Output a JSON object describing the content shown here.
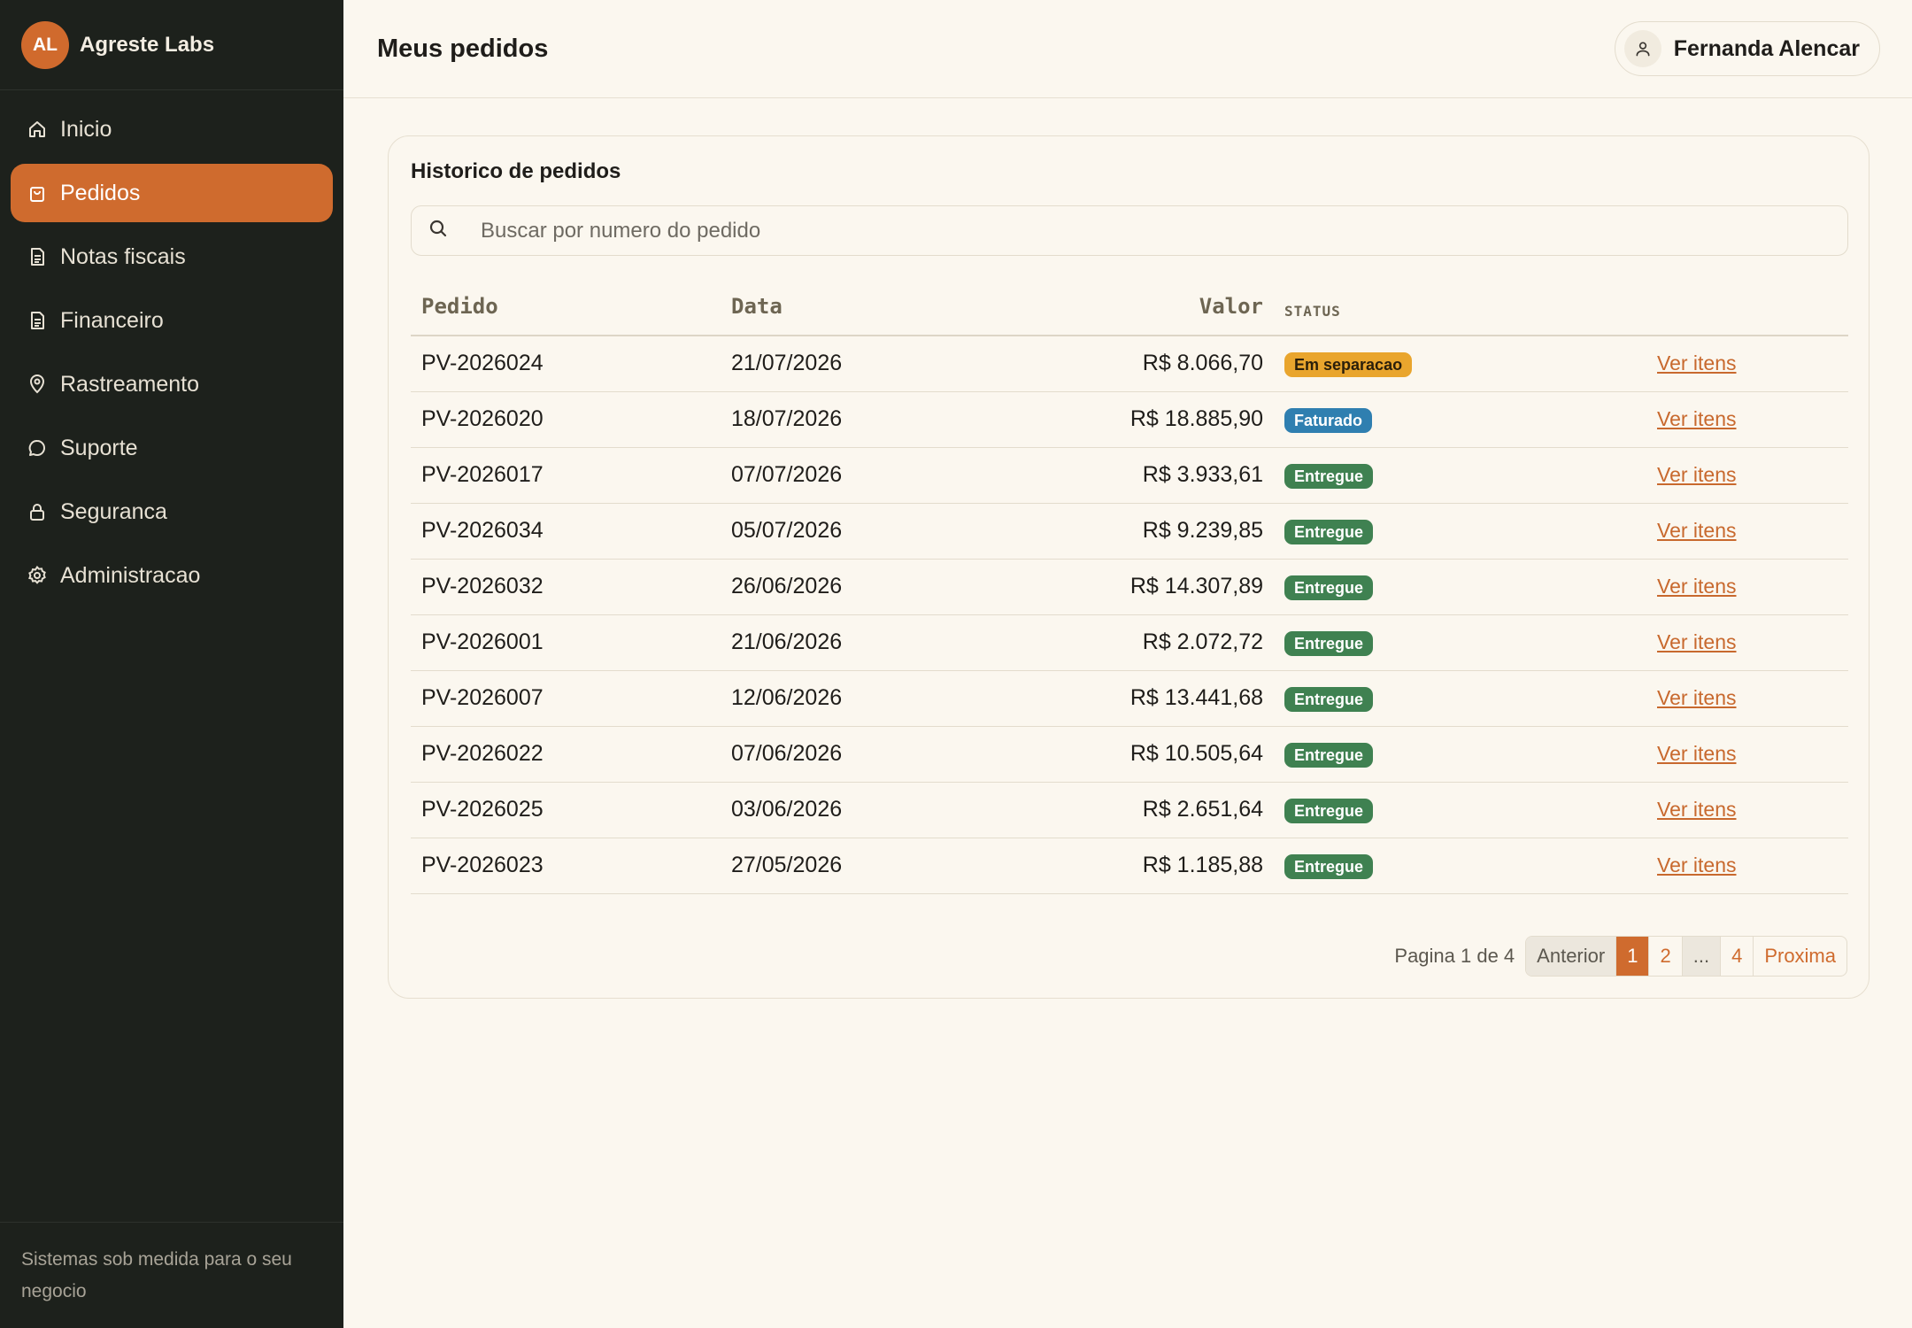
{
  "brand": {
    "initials": "AL",
    "name": "Agreste Labs"
  },
  "sidebar": {
    "items": [
      {
        "label": "Inicio",
        "icon": "home-icon",
        "active": false
      },
      {
        "label": "Pedidos",
        "icon": "shopping-bag-icon",
        "active": true
      },
      {
        "label": "Notas fiscais",
        "icon": "document-icon",
        "active": false
      },
      {
        "label": "Financeiro",
        "icon": "document-icon",
        "active": false
      },
      {
        "label": "Rastreamento",
        "icon": "map-pin-icon",
        "active": false
      },
      {
        "label": "Suporte",
        "icon": "chat-bubble-icon",
        "active": false
      },
      {
        "label": "Seguranca",
        "icon": "lock-icon",
        "active": false
      },
      {
        "label": "Administracao",
        "icon": "gear-icon",
        "active": false
      }
    ],
    "footer": "Sistemas sob medida para o seu negocio"
  },
  "header": {
    "title": "Meus pedidos",
    "user_name": "Fernanda Alencar"
  },
  "card": {
    "title": "Historico de pedidos",
    "search_placeholder": "Buscar por numero do pedido"
  },
  "table": {
    "columns": [
      "Pedido",
      "Data",
      "Valor",
      "STATUS"
    ],
    "rows": [
      {
        "id": "PV-2026024",
        "date": "21/07/2026",
        "value": "R$ 8.066,70",
        "status": "Em separacao",
        "action": "Ver itens"
      },
      {
        "id": "PV-2026020",
        "date": "18/07/2026",
        "value": "R$ 18.885,90",
        "status": "Faturado",
        "action": "Ver itens"
      },
      {
        "id": "PV-2026017",
        "date": "07/07/2026",
        "value": "R$ 3.933,61",
        "status": "Entregue",
        "action": "Ver itens"
      },
      {
        "id": "PV-2026034",
        "date": "05/07/2026",
        "value": "R$ 9.239,85",
        "status": "Entregue",
        "action": "Ver itens"
      },
      {
        "id": "PV-2026032",
        "date": "26/06/2026",
        "value": "R$ 14.307,89",
        "status": "Entregue",
        "action": "Ver itens"
      },
      {
        "id": "PV-2026001",
        "date": "21/06/2026",
        "value": "R$ 2.072,72",
        "status": "Entregue",
        "action": "Ver itens"
      },
      {
        "id": "PV-2026007",
        "date": "12/06/2026",
        "value": "R$ 13.441,68",
        "status": "Entregue",
        "action": "Ver itens"
      },
      {
        "id": "PV-2026022",
        "date": "07/06/2026",
        "value": "R$ 10.505,64",
        "status": "Entregue",
        "action": "Ver itens"
      },
      {
        "id": "PV-2026025",
        "date": "03/06/2026",
        "value": "R$ 2.651,64",
        "status": "Entregue",
        "action": "Ver itens"
      },
      {
        "id": "PV-2026023",
        "date": "27/05/2026",
        "value": "R$ 1.185,88",
        "status": "Entregue",
        "action": "Ver itens"
      }
    ],
    "status_colors": {
      "Em separacao": {
        "bg": "#e9a52d",
        "fg": "#2a1e0a"
      },
      "Faturado": {
        "bg": "#2f7fb0",
        "fg": "#ffffff"
      },
      "Entregue": {
        "bg": "#3f8151",
        "fg": "#ffffff"
      }
    }
  },
  "pagination": {
    "text": "Pagina 1 de 4",
    "prev": "Anterior",
    "pages": [
      "1",
      "2",
      "...",
      "4"
    ],
    "current": "1",
    "next": "Proxima"
  },
  "colors": {
    "accent": "#cf6b2e",
    "sidebar_bg": "#1d211c",
    "page_bg": "#fbf7ef"
  }
}
